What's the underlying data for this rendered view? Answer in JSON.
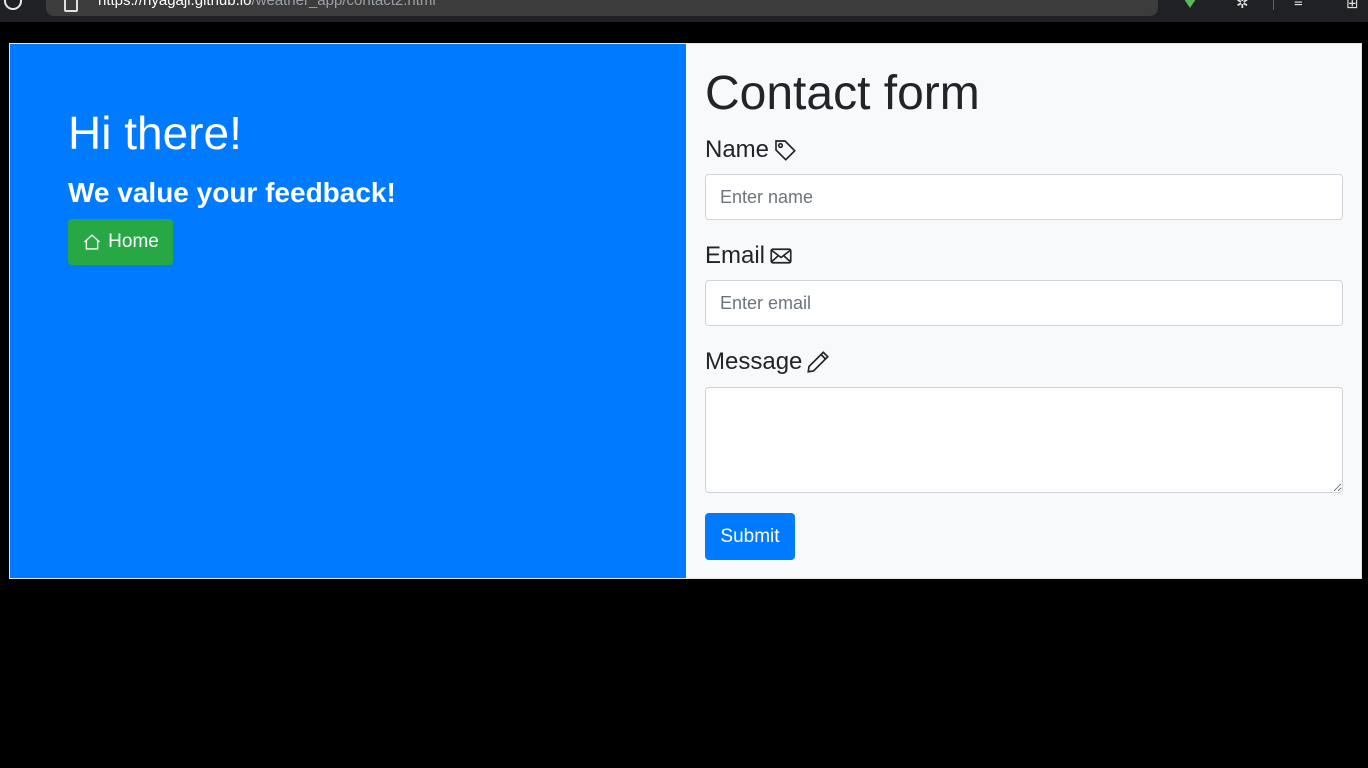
{
  "browser": {
    "url_host": "https://nyagaji.github.io",
    "url_path": "/weather_app/contact2.html"
  },
  "hero": {
    "greeting": "Hi there!",
    "tagline": "We value your feedback!",
    "home_label": "Home",
    "home_icon": "house-icon"
  },
  "form": {
    "title": "Contact form",
    "name_label": "Name",
    "name_icon": "tag-icon",
    "name_placeholder": "Enter name",
    "email_label": "Email",
    "email_icon": "envelope-icon",
    "email_placeholder": "Enter email",
    "message_label": "Message",
    "message_icon": "pencil-icon",
    "submit_label": "Submit"
  },
  "colors": {
    "hero_bg": "#007bff",
    "home_btn": "#28a745",
    "submit_btn": "#007bff",
    "form_bg": "#f8f9fa"
  }
}
